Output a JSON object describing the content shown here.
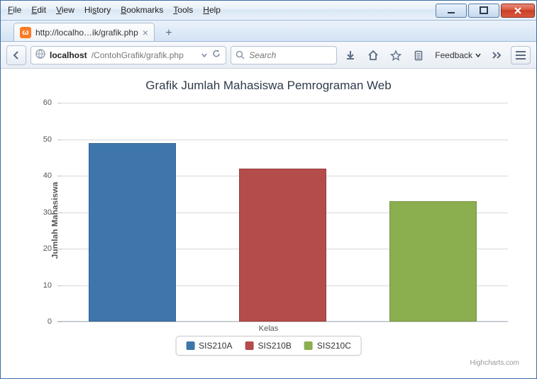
{
  "window": {
    "menu": [
      "File",
      "Edit",
      "View",
      "History",
      "Bookmarks",
      "Tools",
      "Help"
    ]
  },
  "tab": {
    "title": "http://localho…ik/grafik.php"
  },
  "url": {
    "host": "localhost",
    "path": "/ContohGrafik/grafik.php"
  },
  "search": {
    "placeholder": "Search"
  },
  "toolbar": {
    "feedback": "Feedback"
  },
  "chart_data": {
    "type": "bar",
    "title": "Grafik Jumlah Mahasiswa Pemrograman Web",
    "xlabel": "Kelas",
    "ylabel": "Jumlah Mahasiswa",
    "ylim": [
      0,
      60
    ],
    "yticks": [
      0,
      10,
      20,
      30,
      40,
      50,
      60
    ],
    "categories": [
      "SIS210A",
      "SIS210B",
      "SIS210C"
    ],
    "values": [
      49,
      42,
      33
    ],
    "colors": [
      "#3e76ac",
      "#b34c4a",
      "#8bae4f"
    ],
    "credits": "Highcharts.com"
  }
}
